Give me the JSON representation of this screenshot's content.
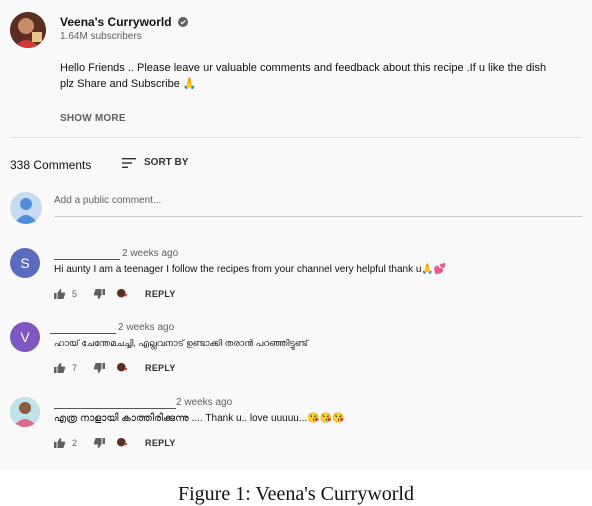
{
  "channel": {
    "name": "Veena's Curryworld",
    "subscribers": "1.64M subscribers"
  },
  "description": {
    "line1": "Hello Friends .. Please leave ur valuable comments and feedback about this recipe .If u like the dish",
    "line2": "plz Share and Subscribe 🙏",
    "show_more": "SHOW MORE"
  },
  "comments_header": {
    "count": "338 Comments",
    "sort_label": "SORT BY"
  },
  "add_comment": {
    "placeholder": "Add a public comment..."
  },
  "comments": [
    {
      "avatar_letter": "S",
      "avatar_color": "#5c6bc0",
      "time": "2 weeks ago",
      "text": "Hi aunty I am a teenager I follow the recipes from your channel very helpful  thank u🙏💕",
      "likes": "5",
      "reply": "REPLY"
    },
    {
      "avatar_letter": "V",
      "avatar_color": "#7e57c2",
      "time": "2 weeks ago",
      "text": "ഹായ് ചേന്തേമചച്ചി, എല്ലവനാട് ഉണ്ടാക്കി തരാൻ പറഞ്ഞിട്ടുണ്ട്",
      "likes": "7",
      "reply": "REPLY"
    },
    {
      "avatar_letter": "",
      "avatar_color": "#d8a98a",
      "time": "2 weeks ago",
      "text": "എത്ര നാളായി കാത്തിരിക്കുന്നു .... Thank u.. love uuuuu...😘😘😘",
      "likes": "2",
      "reply": "REPLY"
    }
  ],
  "caption": "Figure 1: Veena's Curryworld"
}
